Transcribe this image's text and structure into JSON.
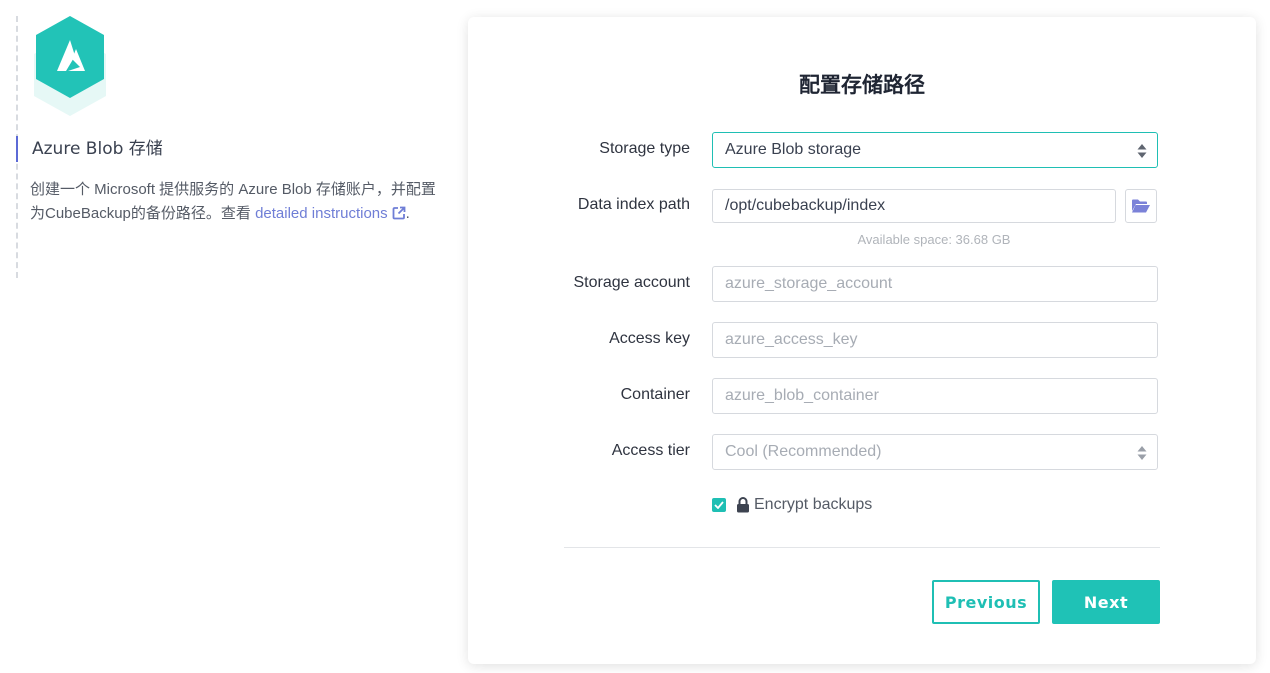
{
  "side": {
    "title": "Azure Blob 存储",
    "desc_text": "创建一个 Microsoft 提供服务的 Azure Blob 存储账户，并配置为CubeBackup的备份路径。查看 ",
    "link_text": "detailed instructions",
    "desc_end": "."
  },
  "form": {
    "title": "配置存储路径",
    "storage_type": {
      "label": "Storage type",
      "value": "Azure Blob storage"
    },
    "data_index_path": {
      "label": "Data index path",
      "value": "/opt/cubebackup/index",
      "available": "Available space: 36.68 GB"
    },
    "storage_account": {
      "label": "Storage account",
      "placeholder": "azure_storage_account"
    },
    "access_key": {
      "label": "Access key",
      "placeholder": "azure_access_key"
    },
    "container": {
      "label": "Container",
      "placeholder": "azure_blob_container"
    },
    "access_tier": {
      "label": "Access tier",
      "value": "Cool (Recommended)"
    },
    "encrypt": {
      "label": "Encrypt backups",
      "checked": true
    }
  },
  "buttons": {
    "previous": "Previous",
    "next": "Next"
  },
  "colors": {
    "accent": "#1fbfb4",
    "link": "#6f7ed6",
    "side_marker": "#5c6ad6"
  },
  "icons": [
    "azure-logo",
    "external-link-icon",
    "sort-icon",
    "folder-open-icon",
    "check-icon",
    "lock-icon"
  ]
}
